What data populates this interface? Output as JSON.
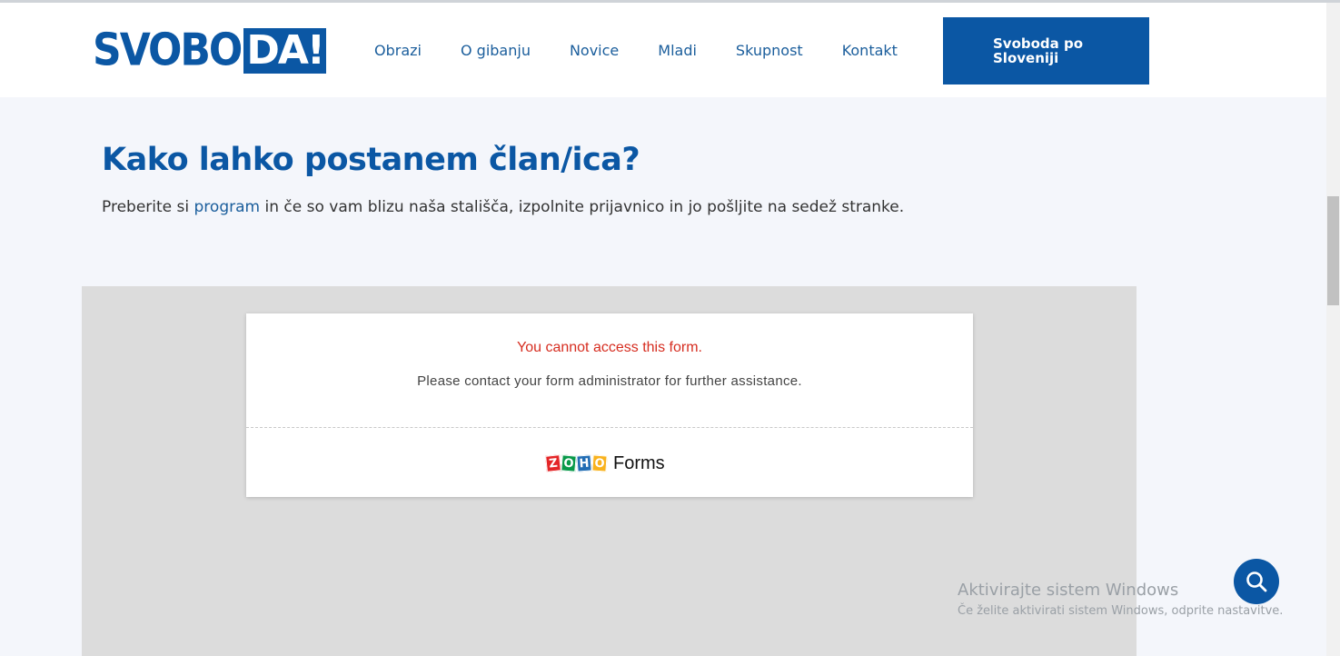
{
  "header": {
    "logo_part1": "SVOBO",
    "logo_part2": "DA!",
    "nav": [
      "Obrazi",
      "O gibanju",
      "Novice",
      "Mladi",
      "Skupnost",
      "Kontakt"
    ],
    "cta_label": "Svoboda po Sloveniji"
  },
  "main": {
    "title": "Kako lahko postanem član/ica?",
    "intro_before": "Preberite si ",
    "intro_link": "program",
    "intro_after": " in če so vam blizu naša stališča, izpolnite prijavnico in jo pošljite na sedež stranke."
  },
  "form_embed": {
    "error": "You cannot access this form.",
    "message": "Please contact your form administrator for further assistance.",
    "brand_letters": [
      "Z",
      "O",
      "H",
      "O"
    ],
    "brand_colors": [
      "#e42527",
      "#089949",
      "#226db4",
      "#f9b21d"
    ],
    "brand_word": "Forms"
  },
  "watermark": {
    "line1": "Aktivirajte sistem Windows",
    "line2": "Če želite aktivirati sistem Windows, odprite nastavitve."
  },
  "colors": {
    "brand_blue": "#0b57a4",
    "error_red": "#d62d20"
  },
  "icons": {
    "search_button": "search-icon"
  }
}
